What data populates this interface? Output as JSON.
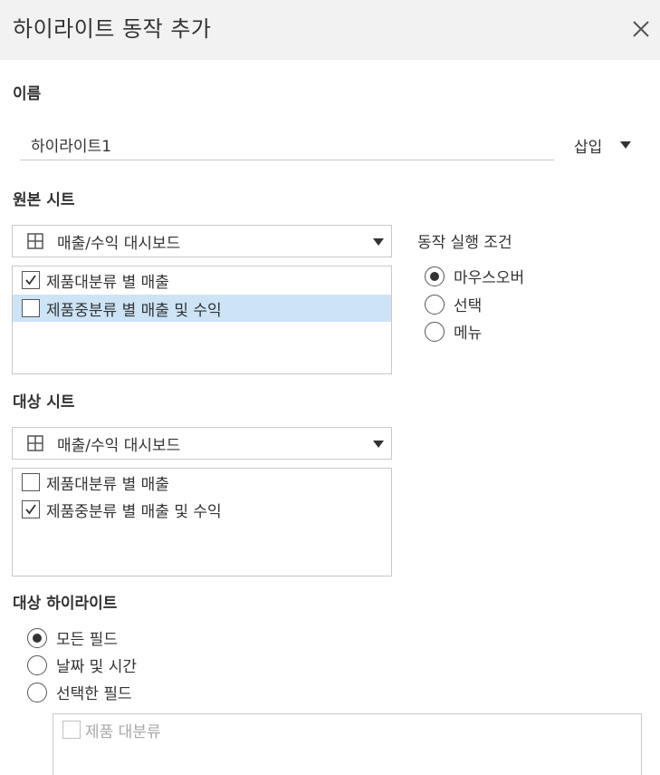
{
  "dialog": {
    "title": "하이라이트 동작 추가",
    "close_icon": "close-icon"
  },
  "name_section": {
    "label": "이름",
    "value": "하이라이트1",
    "insert_label": "삽입"
  },
  "source_section": {
    "label": "원본 시트",
    "selected_sheet": "매출/수익 대시보드",
    "sheet_icon": "grid-icon",
    "items": [
      {
        "label": "제품대분류 별 매출",
        "checked": true,
        "selected": false
      },
      {
        "label": "제품중분류 별 매출 및 수익",
        "checked": false,
        "selected": true
      }
    ]
  },
  "trigger_section": {
    "label": "동작 실행 조건",
    "options": [
      {
        "label": "마우스오버",
        "selected": true
      },
      {
        "label": "선택",
        "selected": false
      },
      {
        "label": "메뉴",
        "selected": false
      }
    ]
  },
  "target_section": {
    "label": "대상 시트",
    "selected_sheet": "매출/수익 대시보드",
    "sheet_icon": "grid-icon",
    "items": [
      {
        "label": "제품대분류 별 매출",
        "checked": false,
        "selected": false
      },
      {
        "label": "제품중분류 별 매출 및 수익",
        "checked": true,
        "selected": false
      }
    ]
  },
  "highlight_section": {
    "label": "대상 하이라이트",
    "options": [
      {
        "label": "모든 필드",
        "selected": true
      },
      {
        "label": "날짜 및 시간",
        "selected": false
      },
      {
        "label": "선택한 필드",
        "selected": false
      }
    ],
    "fields": [
      {
        "label": "제품 대분류",
        "checked": false,
        "disabled": true
      }
    ]
  },
  "colors": {
    "header_bg": "#f2f2f2",
    "selected_row": "#cde4f7",
    "border": "#c8c8c8",
    "text": "#333333",
    "disabled_text": "#a8a8a8"
  }
}
